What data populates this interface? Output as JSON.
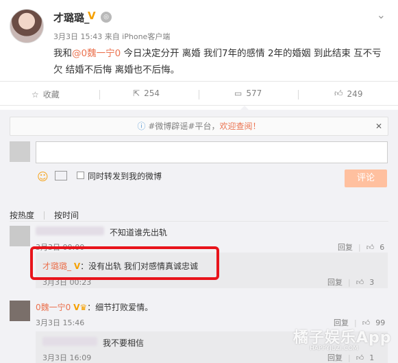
{
  "post": {
    "author": "才璐璐_",
    "meta": "3月3日 15:43 来自 iPhone客户端",
    "text_before": "我和",
    "mention": "@0魏一宁0",
    "text_after": " 今日决定分开 离婚 我们7年的感情 2年的婚姻 到此结束 互不亏欠 结婚不后悔 离婚也不后悔。"
  },
  "actions": {
    "favorite": "收藏",
    "repost": "254",
    "comment": "577",
    "like": "249"
  },
  "notice": {
    "prefix": "#微博辟谣#平台，",
    "link": "欢迎查阅！"
  },
  "composer": {
    "repost_label": "同时转发到我的微博",
    "submit": "评论"
  },
  "sort": {
    "hot": "按热度",
    "time": "按时间"
  },
  "comments": [
    {
      "text": "不知道谁先出轨",
      "time": "3月3日 00:00",
      "reply": "回复",
      "likes": "6",
      "reply_thread": {
        "name": "才璐璐_",
        "text": "：没有出轨 我们对感情真诚忠诚",
        "time": "3月3日 00:23",
        "reply": "回复",
        "likes": "3"
      }
    },
    {
      "name": "0魏一宁0",
      "text": "：细节打败爱情。",
      "time": "3月3日 15:46",
      "reply": "回复",
      "likes": "99",
      "reply_thread": {
        "text": "我不要相信",
        "time": "3月3日 16:09",
        "reply": "回复",
        "likes": "1"
      }
    }
  ],
  "watermark": {
    "title": "橘子娱乐App",
    "sub": "HAPPYJUZI.COM"
  },
  "colors": {
    "accent": "#eb7350",
    "submit": "#ffc09f",
    "highlight": "#e8141b"
  }
}
